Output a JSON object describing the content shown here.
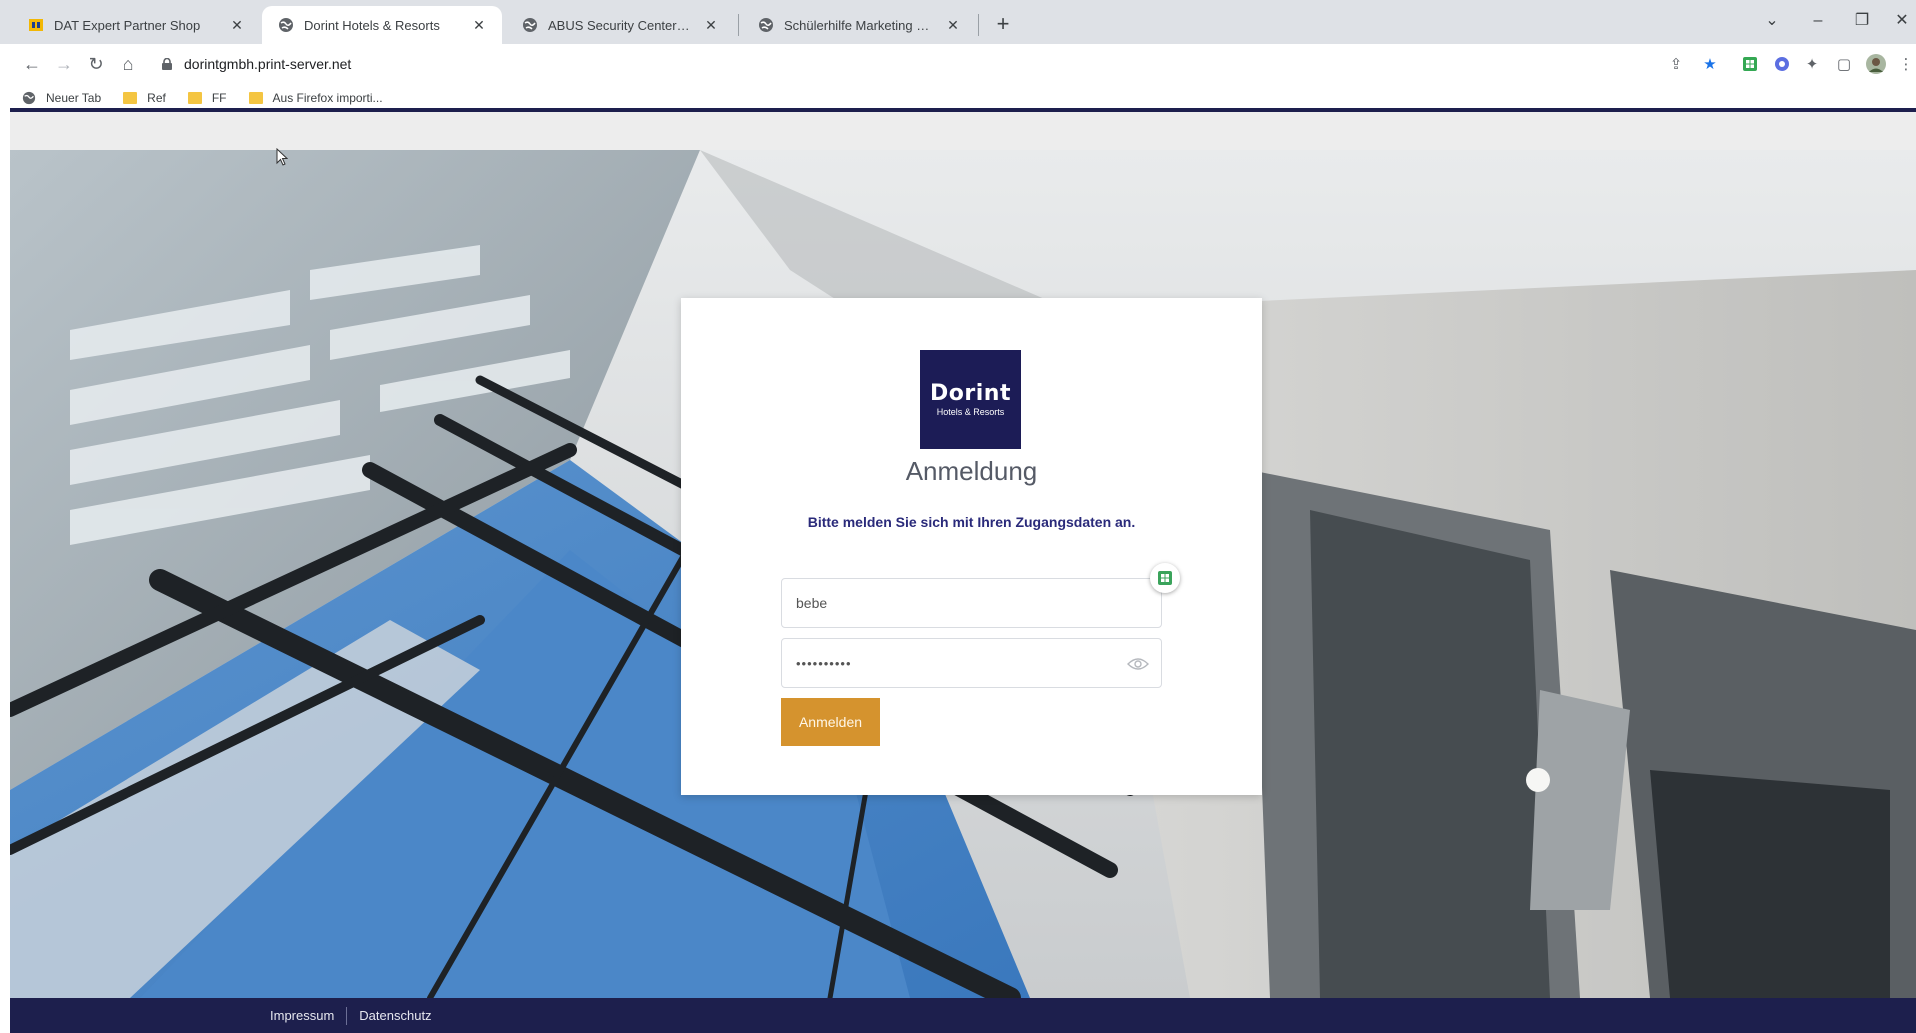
{
  "browser": {
    "tabs": [
      {
        "title": "DAT Expert Partner Shop",
        "favicon": "dat-logo-icon"
      },
      {
        "title": "Dorint Hotels & Resorts",
        "favicon": "globe-icon"
      },
      {
        "title": "ABUS Security CenterGmbH & ...",
        "favicon": "globe-icon"
      },
      {
        "title": "Schülerhilfe Marketing Center ...",
        "favicon": "globe-icon"
      }
    ],
    "new_tab": "+",
    "address": "dorintgmbh.print-server.net",
    "bookmarks": [
      {
        "label": "Neuer Tab",
        "icon": "globe-icon"
      },
      {
        "label": "Ref",
        "icon": "folder-icon"
      },
      {
        "label": "FF",
        "icon": "folder-icon"
      },
      {
        "label": "Aus Firefox importi...",
        "icon": "folder-icon"
      }
    ]
  },
  "login": {
    "logo_brand": "Dorint",
    "logo_sub": "Hotels & Resorts",
    "title": "Anmeldung",
    "subtitle": "Bitte melden Sie sich mit Ihren Zugangsdaten an.",
    "username_value": "bebe",
    "password_value": "••••••••••",
    "submit_label": "Anmelden"
  },
  "footer": {
    "links": [
      "Impressum",
      "Datenschutz"
    ]
  },
  "colors": {
    "brand_navy": "#1d1f4d",
    "logo_navy": "#1c1c56",
    "button_gold": "#d5932e",
    "subtitle_blue": "#2a2a7a"
  }
}
